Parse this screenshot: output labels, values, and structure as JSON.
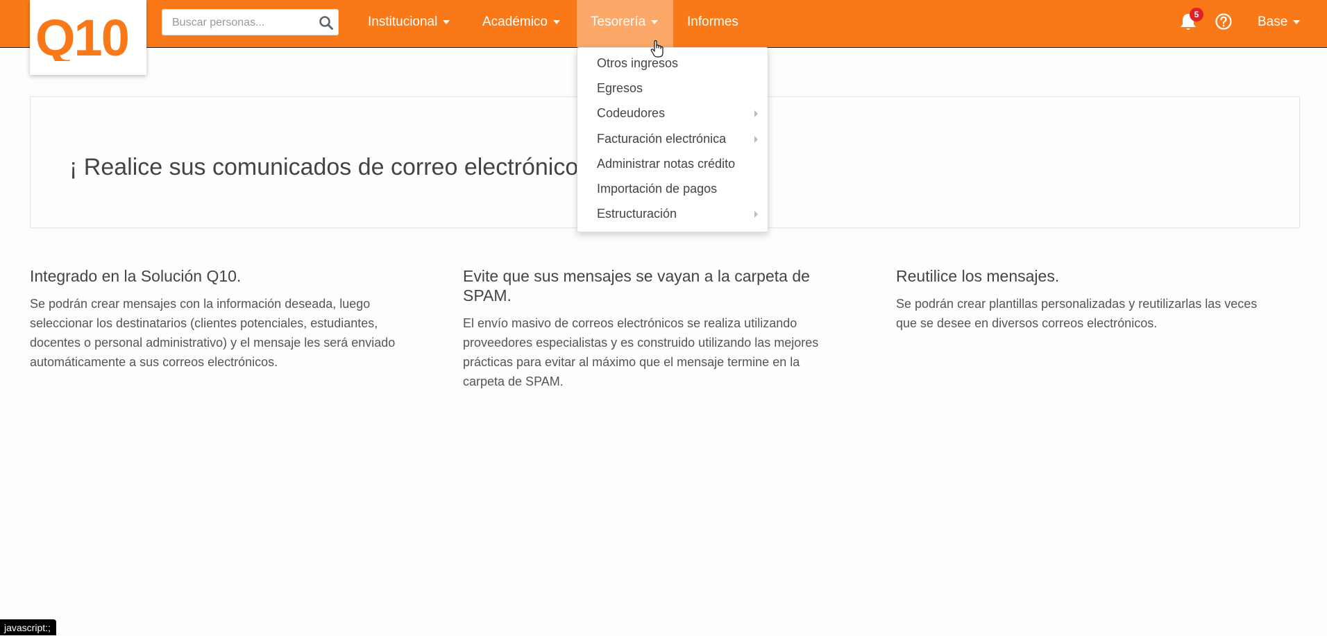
{
  "brand": {
    "logo_text": "Q10",
    "color": "#f97919"
  },
  "search": {
    "placeholder": "Buscar personas..."
  },
  "nav": {
    "institucional": "Institucional",
    "academico": "Académico",
    "tesoreria": "Tesorería",
    "informes": "Informes",
    "base": "Base"
  },
  "notifications": {
    "count": "5"
  },
  "dropdown": {
    "items": [
      {
        "label": "Otros ingresos",
        "submenu": false
      },
      {
        "label": "Egresos",
        "submenu": false
      },
      {
        "label": "Codeudores",
        "submenu": true
      },
      {
        "label": "Facturación electrónica",
        "submenu": true
      },
      {
        "label": "Administrar notas crédito",
        "submenu": false
      },
      {
        "label": "Importación de pagos",
        "submenu": false
      },
      {
        "label": "Estructuración",
        "submenu": true
      }
    ]
  },
  "banner": {
    "text": "¡ Realice sus comunicados de correo electrónico c"
  },
  "features": [
    {
      "title": "Integrado en la Solución Q10.",
      "lines": [
        "Se podrán crear mensajes con la información deseada, luego",
        "seleccionar los destinatarios (clientes potenciales, estudiantes,",
        "docentes o personal administrativo) y el mensaje les será enviado",
        "automáticamente a sus correos electrónicos."
      ]
    },
    {
      "title_lines": [
        "Evite que sus mensajes se vayan a la carpeta de",
        "SPAM."
      ],
      "lines": [
        "El envío masivo de correos electrónicos se realiza utilizando",
        "proveedores especialistas y es construido utilizando las mejores",
        "prácticas para evitar al máximo que el mensaje termine en la",
        "carpeta de SPAM."
      ]
    },
    {
      "title": "Reutilice los mensajes.",
      "lines": [
        "Se podrán crear plantillas personalizadas y reutilizarlas las veces",
        "que se desee en diversos correos electrónicos."
      ]
    }
  ],
  "statusbar": {
    "text": "javascript:;"
  }
}
